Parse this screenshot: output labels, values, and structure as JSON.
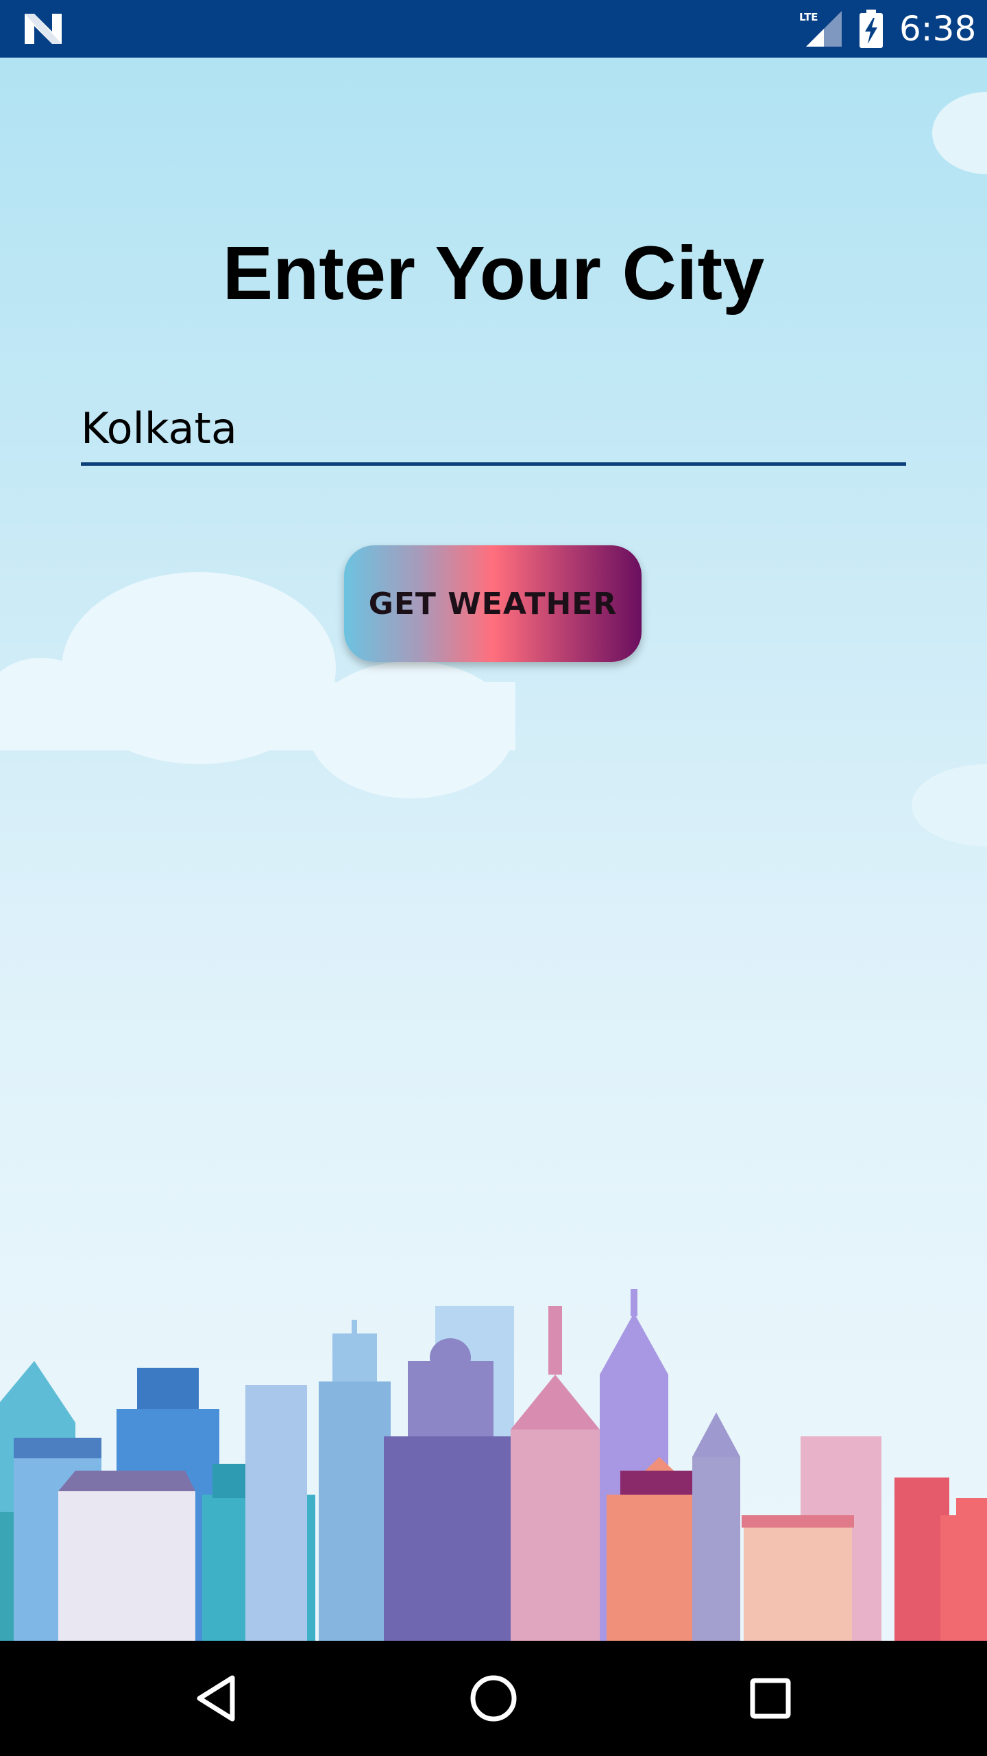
{
  "status_bar": {
    "time": "6:38",
    "network": "LTE",
    "icons": [
      "notification-n-icon",
      "lte-signal-icon",
      "battery-charging-icon"
    ]
  },
  "main": {
    "title": "Enter Your City",
    "city_input": {
      "value": "Kolkata",
      "placeholder": ""
    },
    "button_label": "GET WEATHER"
  },
  "nav_bar": {
    "icons": [
      "back-icon",
      "home-icon",
      "recents-icon"
    ]
  },
  "colors": {
    "status_bar": "#053f86",
    "input_underline": "#0d3f7a",
    "sky_top": "#b1e3f3",
    "sky_bottom": "#eaf6fb",
    "button_gradient": [
      "#6cc3e0",
      "#ff6f7d",
      "#6a0f5f"
    ]
  }
}
